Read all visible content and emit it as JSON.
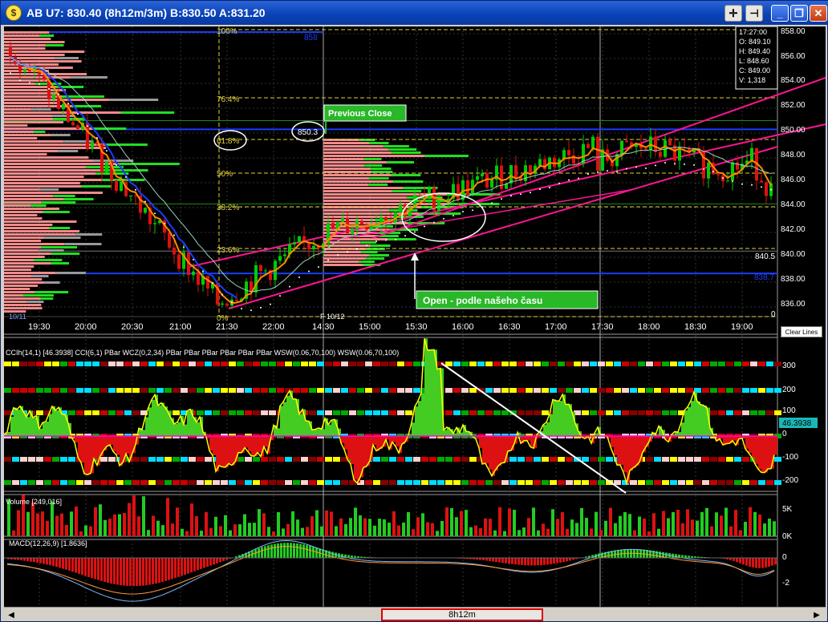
{
  "window": {
    "icon": "dollar-coin-icon",
    "title": "AB U7: 830.40 (8h12m/3m)  B:830.50 A:831.20",
    "buttons": [
      "crosshair-icon",
      "pin-icon",
      "minimize-icon",
      "maximize-icon",
      "close-icon"
    ]
  },
  "colors": {
    "background": "#000000",
    "up_candle": "#00cc00",
    "down_candle": "#dd1111",
    "channel": "#ff1493",
    "ma_orange": "#ff8c00",
    "ma_blue": "#1a3cff",
    "fib": "#e0d040",
    "annotation_green": "#20c020"
  },
  "price_panel": {
    "ohlc_box": [
      "17:27:00",
      "O: 849.10",
      "H: 849.40",
      "L: 848.60",
      "C: 849.00",
      "V: 1,318"
    ],
    "y_ticks": [
      "858.00",
      "856.00",
      "854.00",
      "852.00",
      "850.00",
      "848.00",
      "846.00",
      "844.00",
      "842.00",
      "840.00",
      "838.00",
      "836.00"
    ],
    "x_ticks": [
      "19:30",
      "20:00",
      "20:30",
      "21:00",
      "21:30",
      "22:00",
      "14:30",
      "15:00",
      "15:30",
      "16:00",
      "16:30",
      "17:00",
      "17:30",
      "18:00",
      "18:30",
      "19:00"
    ],
    "session_labels": [
      "10/11",
      "F 10/12"
    ],
    "fib_levels": [
      "100%",
      "76.4%",
      "61.8%",
      "50%",
      "38.2%",
      "23.6%",
      "0%"
    ],
    "level_labels": [
      "858",
      "850.3",
      "840.5",
      "838.7"
    ],
    "annotations": {
      "previous_close": "Previous Close",
      "open": "Open - podle našeho času"
    },
    "clear_lines": "Clear Lines",
    "corner_zero": "0"
  },
  "cci_panel": {
    "header": "CCIh(14,1)  [46.3938]   CCI(6,1)  PBar  WCZ(0,2,34)  PBar  PBar  PBar  PBar  PBar  PBar  WSW(0.06,70,100)  WSW(0.06,70,100)",
    "y_ticks": [
      "300",
      "200",
      "100",
      "0",
      "-100",
      "-200"
    ],
    "current_value": "46.3938"
  },
  "volume_panel": {
    "header": "Volume  [249,016]",
    "y_ticks": [
      "5K",
      "0K"
    ]
  },
  "macd_panel": {
    "header": "MACD(12,26,9)  [1.8636]",
    "y_ticks": [
      "0",
      "-2"
    ]
  },
  "scrollbar": {
    "thumb_label": "8h12m"
  }
}
